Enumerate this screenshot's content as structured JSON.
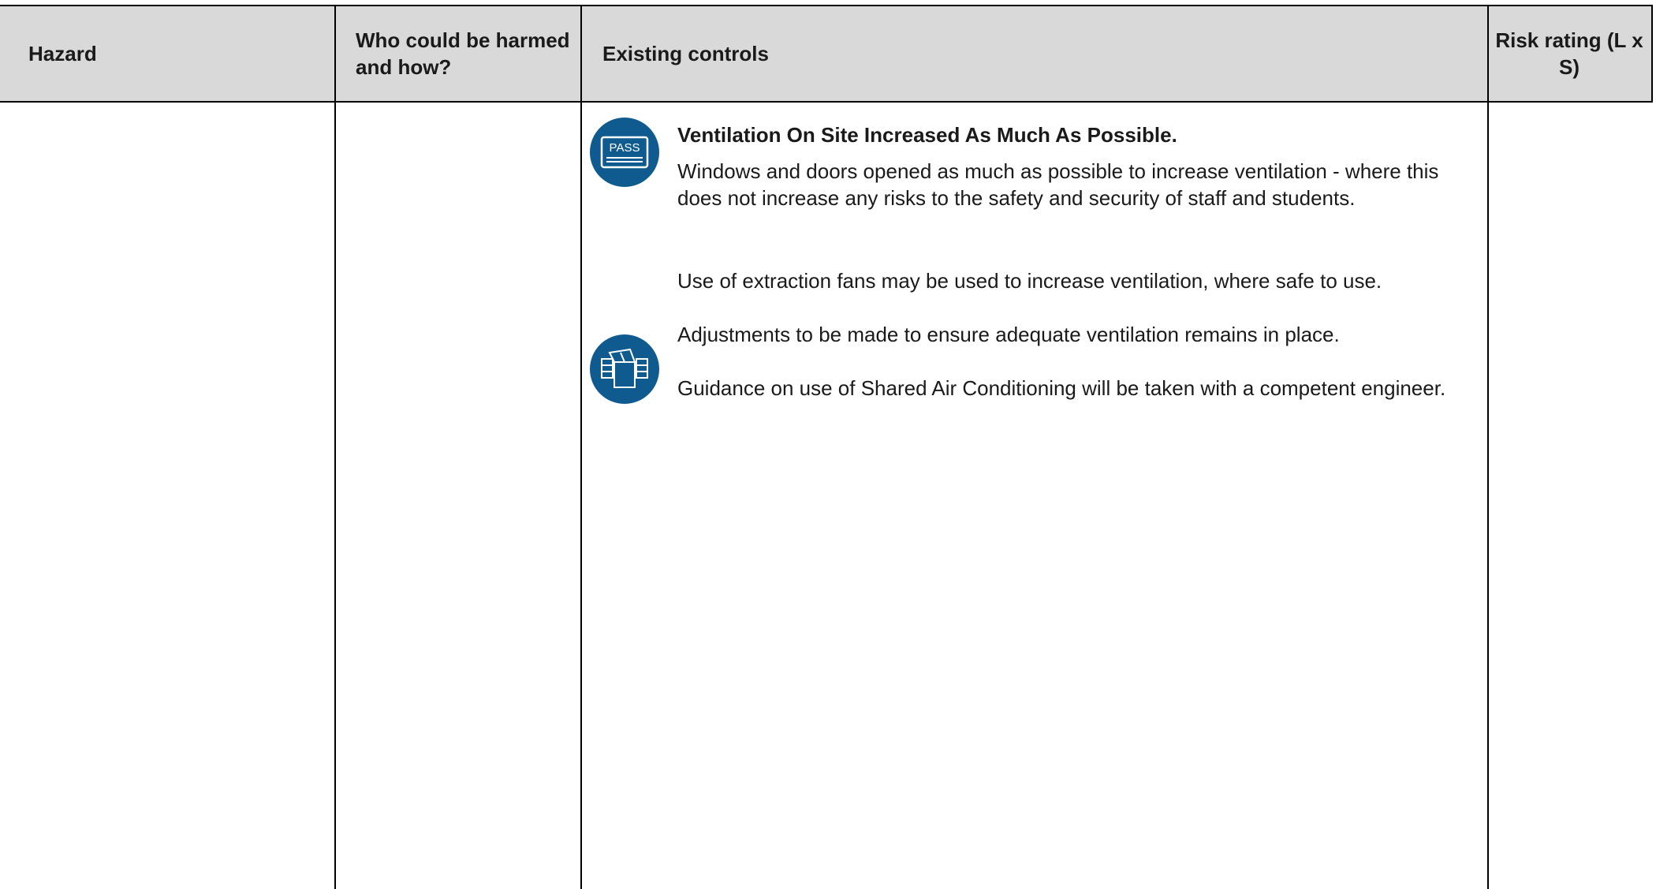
{
  "table": {
    "headers": {
      "hazard": "Hazard",
      "who": "Who could be harmed and how?",
      "controls": "Existing controls",
      "risk": "Risk rating (L x S)"
    },
    "row": {
      "control_title": "Ventilation On Site Increased As Much As Possible.",
      "paragraphs": [
        "Windows and doors opened as much as possible to increase ventilation - where this does not increase any risks to the safety and security of staff and students.",
        "Use of extraction fans may be used to increase ventilation, where safe to use.",
        "Adjustments to be made to ensure adequate ventilation remains in place.",
        "Guidance on use of Shared Air Conditioning will be taken with a competent engineer."
      ],
      "icons": [
        "pass-card-icon",
        "box-icon"
      ],
      "pass_icon_text": "PASS"
    }
  },
  "colors": {
    "header_bg": "#d9d9d9",
    "icon_bg": "#0f5a8e"
  }
}
